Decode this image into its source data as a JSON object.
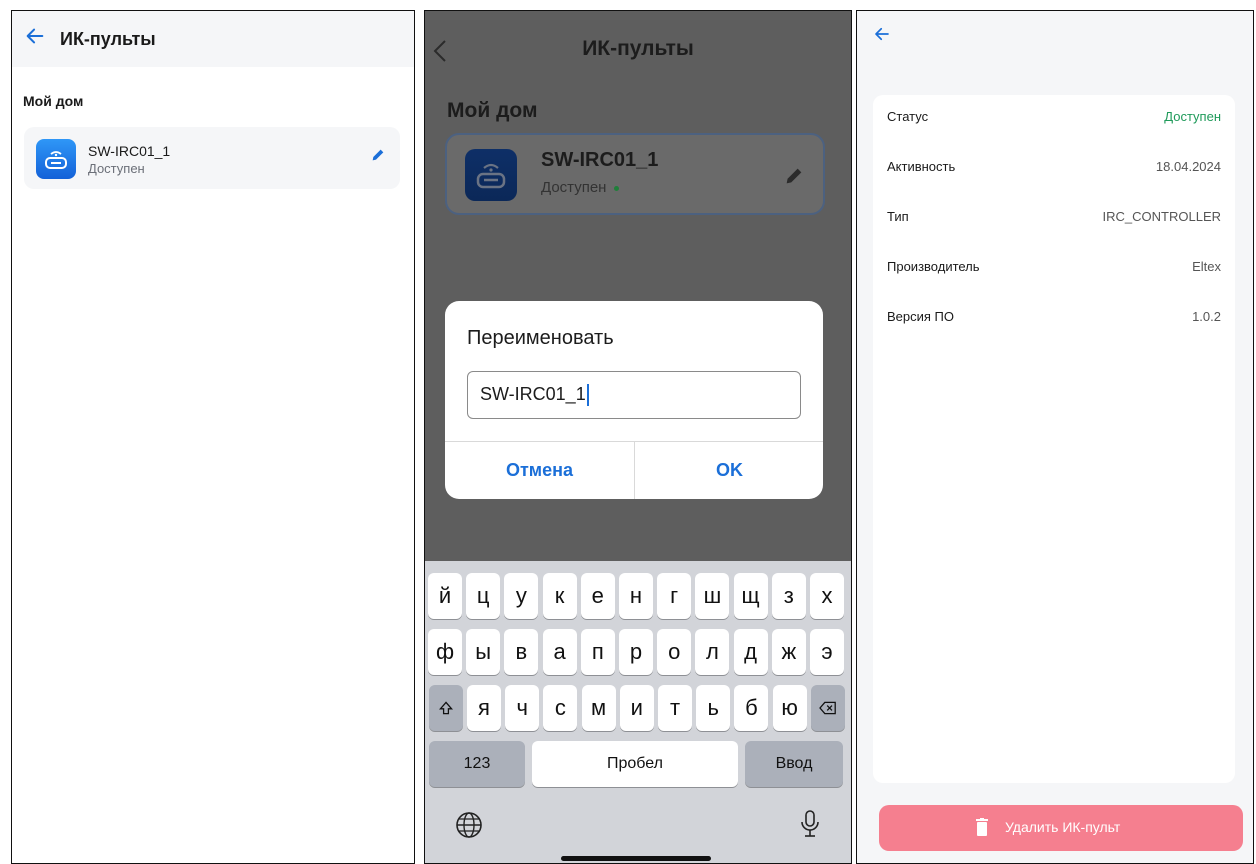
{
  "screen1": {
    "title": "ИК-пульты",
    "section": "Мой дом",
    "device": {
      "name": "SW-IRC01_1",
      "status": "Доступен"
    },
    "icons": {
      "back": "arrow-left-icon",
      "edit": "pencil-icon",
      "device": "remote-control-icon"
    }
  },
  "screen2": {
    "title": "ИК-пульты",
    "section": "Мой дом",
    "device": {
      "name": "SW-IRC01_1",
      "status": "Доступен"
    },
    "dialog": {
      "title": "Переименовать",
      "input_value": "SW-IRC01_1",
      "cancel": "Отмена",
      "ok": "OK"
    },
    "keyboard": {
      "row1": [
        "й",
        "ц",
        "у",
        "к",
        "е",
        "н",
        "г",
        "ш",
        "щ",
        "з",
        "х"
      ],
      "row2": [
        "ф",
        "ы",
        "в",
        "а",
        "п",
        "р",
        "о",
        "л",
        "д",
        "ж",
        "э"
      ],
      "row3": [
        "я",
        "ч",
        "с",
        "м",
        "и",
        "т",
        "ь",
        "б",
        "ю"
      ],
      "numbers": "123",
      "space": "Пробел",
      "enter": "Ввод"
    }
  },
  "screen3": {
    "rows": [
      {
        "label": "Статус",
        "value": "Доступен"
      },
      {
        "label": "Активность",
        "value": "18.04.2024"
      },
      {
        "label": "Тип",
        "value": "IRC_CONTROLLER"
      },
      {
        "label": "Производитель",
        "value": "Eltex"
      },
      {
        "label": "Версия ПО",
        "value": "1.0.2"
      }
    ],
    "delete_label": "Удалить ИК-пульт"
  },
  "colors": {
    "accent": "#1b6fd8",
    "status_ok": "#1f9a5a",
    "delete_button": "#f57f8f",
    "dim_overlay": "#5e5e5e"
  }
}
